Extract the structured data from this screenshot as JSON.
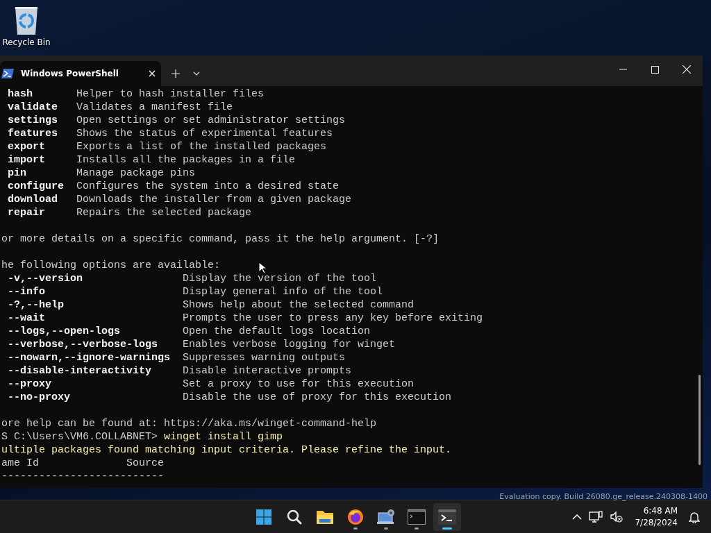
{
  "desktop_icons": [
    {
      "label": "Recycle Bin"
    }
  ],
  "window": {
    "tabs": [
      {
        "title": "Windows PowerShell",
        "selected": true
      }
    ]
  },
  "terminal": {
    "commands": [
      {
        "command": "hash",
        "description": "Helper to hash installer files"
      },
      {
        "command": "validate",
        "description": "Validates a manifest file"
      },
      {
        "command": "settings",
        "description": "Open settings or set administrator settings"
      },
      {
        "command": "features",
        "description": "Shows the status of experimental features"
      },
      {
        "command": "export",
        "description": "Exports a list of the installed packages"
      },
      {
        "command": "import",
        "description": "Installs all the packages in a file"
      },
      {
        "command": "pin",
        "description": "Manage package pins"
      },
      {
        "command": "configure",
        "description": "Configures the system into a desired state"
      },
      {
        "command": "download",
        "description": "Downloads the installer from a given package"
      },
      {
        "command": "repair",
        "description": "Repairs the selected package"
      }
    ],
    "help_note": "or more details on a specific command, pass it the help argument. [-?]",
    "options_heading": "he following options are available:",
    "options": [
      {
        "option": "-v,--version",
        "description": "Display the version of the tool"
      },
      {
        "option": "--info",
        "description": "Display general info of the tool"
      },
      {
        "option": "-?,--help",
        "description": "Shows help about the selected command"
      },
      {
        "option": "--wait",
        "description": "Prompts the user to press any key before exiting"
      },
      {
        "option": "--logs,--open-logs",
        "description": "Open the default logs location"
      },
      {
        "option": "--verbose,--verbose-logs",
        "description": "Enables verbose logging for winget"
      },
      {
        "option": "--nowarn,--ignore-warnings",
        "description": "Suppresses warning outputs"
      },
      {
        "option": "--disable-interactivity",
        "description": "Disable interactive prompts"
      },
      {
        "option": "--proxy",
        "description": "Set a proxy to use for this execution"
      },
      {
        "option": "--no-proxy",
        "description": "Disable the use of proxy for this execution"
      }
    ],
    "more_help": "ore help can be found at: https://aka.ms/winget-command-help",
    "prompt": {
      "path": "S C:\\Users\\VM6.COLLABNET>",
      "command": "winget install gimp"
    },
    "warning": "ultiple packages found matching input criteria. Please refine the input.",
    "table_header": "ame Id              Source",
    "table_rule": "--------------------------"
  },
  "watermark_text": "Evaluation copy. Build 26080.ge_release.240308-1400",
  "taskbar": {
    "apps": [
      {
        "kind": "start",
        "running": false,
        "selected": false
      },
      {
        "kind": "search",
        "running": false,
        "selected": false
      },
      {
        "kind": "folder",
        "running": false,
        "selected": false
      },
      {
        "kind": "browser",
        "running": true,
        "selected": false
      },
      {
        "kind": "control-panel",
        "running": true,
        "selected": false
      },
      {
        "kind": "console",
        "running": true,
        "selected": false
      },
      {
        "kind": "terminal",
        "running": true,
        "selected": true
      }
    ],
    "time": "6:48 AM",
    "date": "7/28/2024"
  }
}
